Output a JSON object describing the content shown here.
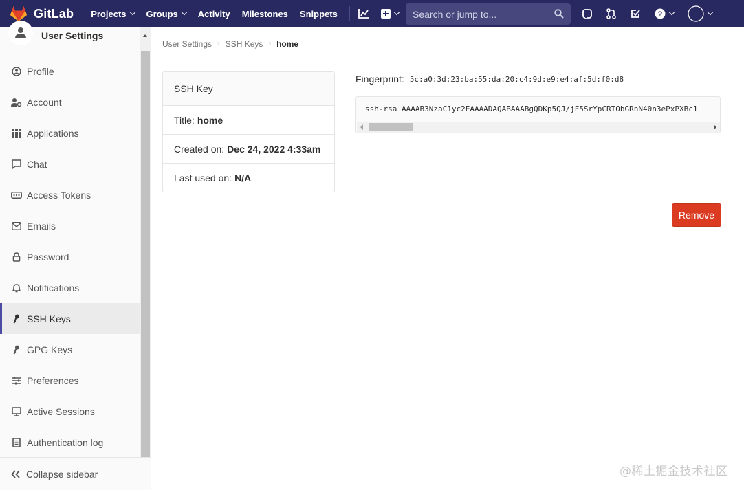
{
  "navbar": {
    "brand": "GitLab",
    "links": [
      {
        "label": "Projects",
        "dropdown": true
      },
      {
        "label": "Groups",
        "dropdown": true
      },
      {
        "label": "Activity",
        "dropdown": false
      },
      {
        "label": "Milestones",
        "dropdown": false
      },
      {
        "label": "Snippets",
        "dropdown": false
      }
    ],
    "search_placeholder": "Search or jump to...",
    "colors": {
      "bg": "#292961",
      "search_bg": "#47477e"
    }
  },
  "sidebar": {
    "title": "User Settings",
    "items": [
      {
        "label": "Profile",
        "icon": "profile-icon"
      },
      {
        "label": "Account",
        "icon": "account-icon"
      },
      {
        "label": "Applications",
        "icon": "applications-icon"
      },
      {
        "label": "Chat",
        "icon": "chat-icon"
      },
      {
        "label": "Access Tokens",
        "icon": "token-icon"
      },
      {
        "label": "Emails",
        "icon": "email-icon"
      },
      {
        "label": "Password",
        "icon": "lock-icon"
      },
      {
        "label": "Notifications",
        "icon": "bell-icon"
      },
      {
        "label": "SSH Keys",
        "icon": "key-icon",
        "active": true
      },
      {
        "label": "GPG Keys",
        "icon": "key-icon"
      },
      {
        "label": "Preferences",
        "icon": "sliders-icon"
      },
      {
        "label": "Active Sessions",
        "icon": "monitor-icon"
      },
      {
        "label": "Authentication log",
        "icon": "log-icon"
      }
    ],
    "collapse_label": "Collapse sidebar"
  },
  "breadcrumb": {
    "items": [
      "User Settings",
      "SSH Keys"
    ],
    "current": "home"
  },
  "key_card": {
    "header": "SSH Key",
    "title_label": "Title:",
    "title_value": "home",
    "created_label": "Created on:",
    "created_value": "Dec 24, 2022 4:33am",
    "last_used_label": "Last used on:",
    "last_used_value": "N/A"
  },
  "fingerprint": {
    "label": "Fingerprint:",
    "value": "5c:a0:3d:23:ba:55:da:20:c4:9d:e9:e4:af:5d:f0:d8"
  },
  "public_key": "ssh-rsa AAAAB3NzaC1yc2EAAAADAQABAAABgQDKp5QJ/jF5SrYpCRTObGRnN40n3ePxPXBc1",
  "actions": {
    "remove_label": "Remove",
    "remove_color": "#db3b21"
  },
  "watermark": "@稀土掘金技术社区"
}
